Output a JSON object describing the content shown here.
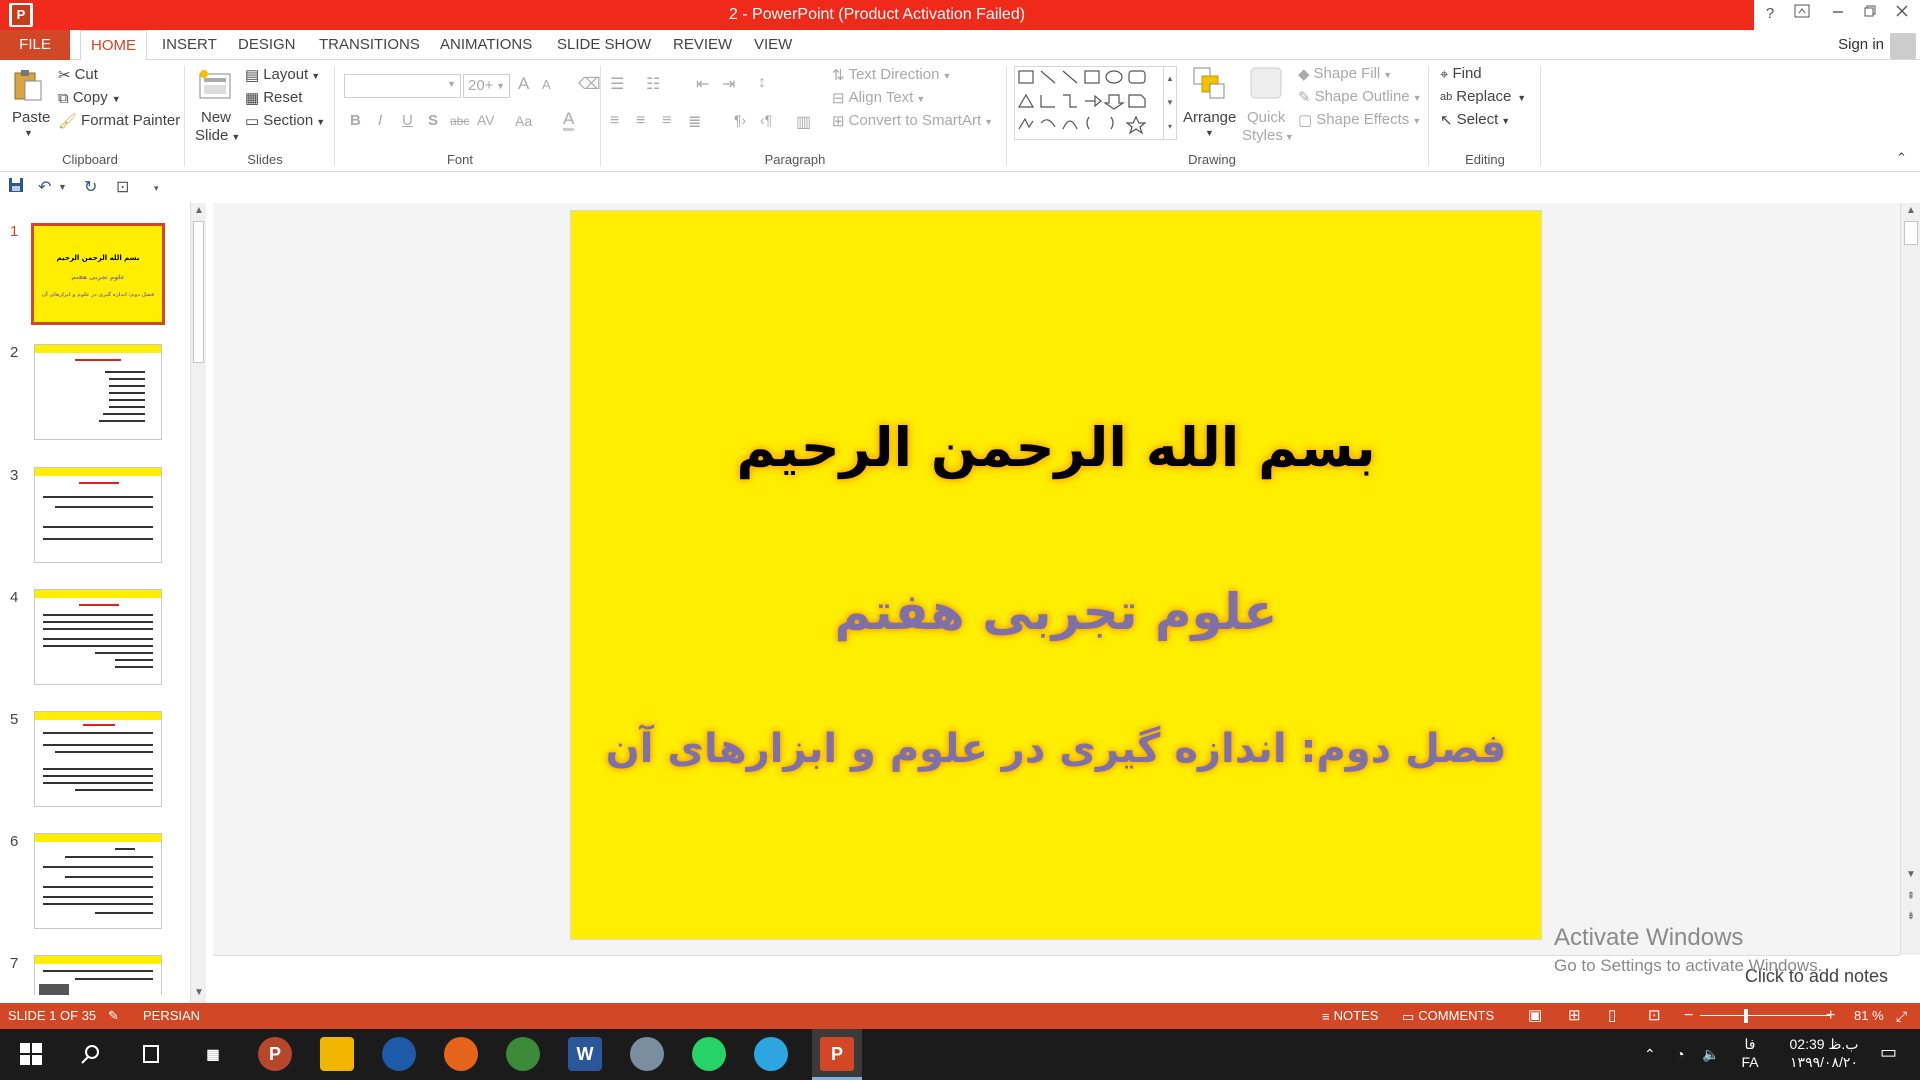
{
  "window": {
    "title": "2 -  PowerPoint (Product Activation Failed)",
    "help": "?",
    "app_icon": "P"
  },
  "tabs": {
    "file": "FILE",
    "items": [
      "HOME",
      "INSERT",
      "DESIGN",
      "TRANSITIONS",
      "ANIMATIONS",
      "SLIDE SHOW",
      "REVIEW",
      "VIEW"
    ],
    "sign_in": "Sign in"
  },
  "ribbon": {
    "clipboard": {
      "label": "Clipboard",
      "paste": "Paste",
      "cut": "Cut",
      "copy": "Copy",
      "format_painter": "Format Painter"
    },
    "slides": {
      "label": "Slides",
      "new_slide_1": "New",
      "new_slide_2": "Slide",
      "layout": "Layout",
      "reset": "Reset",
      "section": "Section"
    },
    "font": {
      "label": "Font",
      "size": "20+",
      "grow": "A",
      "shrink": "A",
      "bold": "B",
      "italic": "I",
      "underline": "U",
      "shadow": "S",
      "strike": "abc",
      "spacing": "AV",
      "case": "Aa",
      "color": "A"
    },
    "paragraph": {
      "label": "Paragraph",
      "text_direction": "Text Direction",
      "align_text": "Align Text",
      "smartart": "Convert to SmartArt"
    },
    "drawing": {
      "label": "Drawing",
      "arrange": "Arrange",
      "quick_styles_1": "Quick",
      "quick_styles_2": "Styles",
      "shape_fill": "Shape Fill",
      "shape_outline": "Shape Outline",
      "shape_effects": "Shape Effects"
    },
    "editing": {
      "label": "Editing",
      "find": "Find",
      "replace": "Replace",
      "select": "Select"
    }
  },
  "thumbnails": [
    "1",
    "2",
    "3",
    "4",
    "5",
    "6",
    "7"
  ],
  "slide": {
    "line1": "بسم الله الرحمن الرحیم",
    "line2": "علوم تجربی هفتم",
    "line3": "فصل دوم: اندازه گیری در علوم و ابزارهای آن",
    "background": "#ffee00",
    "accent": "#8070a8"
  },
  "thumb1": {
    "line1": "بسم الله الرحمن الرحیم",
    "line2": "علوم تجربی هفتم",
    "line3": "فصل دوم: اندازه گیری در علوم و ابزارهای آن"
  },
  "watermark": {
    "line1": "Activate Windows",
    "line2": "Go to Settings to activate Windows."
  },
  "notes_placeholder": "Click to add notes",
  "status": {
    "slide_count": "SLIDE 1 OF 35",
    "language": "PERSIAN",
    "notes": "NOTES",
    "comments": "COMMENTS",
    "zoom": "81 %",
    "minus": "−",
    "plus": "+"
  },
  "taskbar": {
    "time": "02:39 ب.ظ",
    "date": "۱۳۹۹/۰۸/۲۰",
    "lang1": "فا",
    "lang2": "FA"
  },
  "colors": {
    "brand": "#d24726",
    "title_bar": "#ef2a1a",
    "taskbar": "#1b1b1b"
  }
}
